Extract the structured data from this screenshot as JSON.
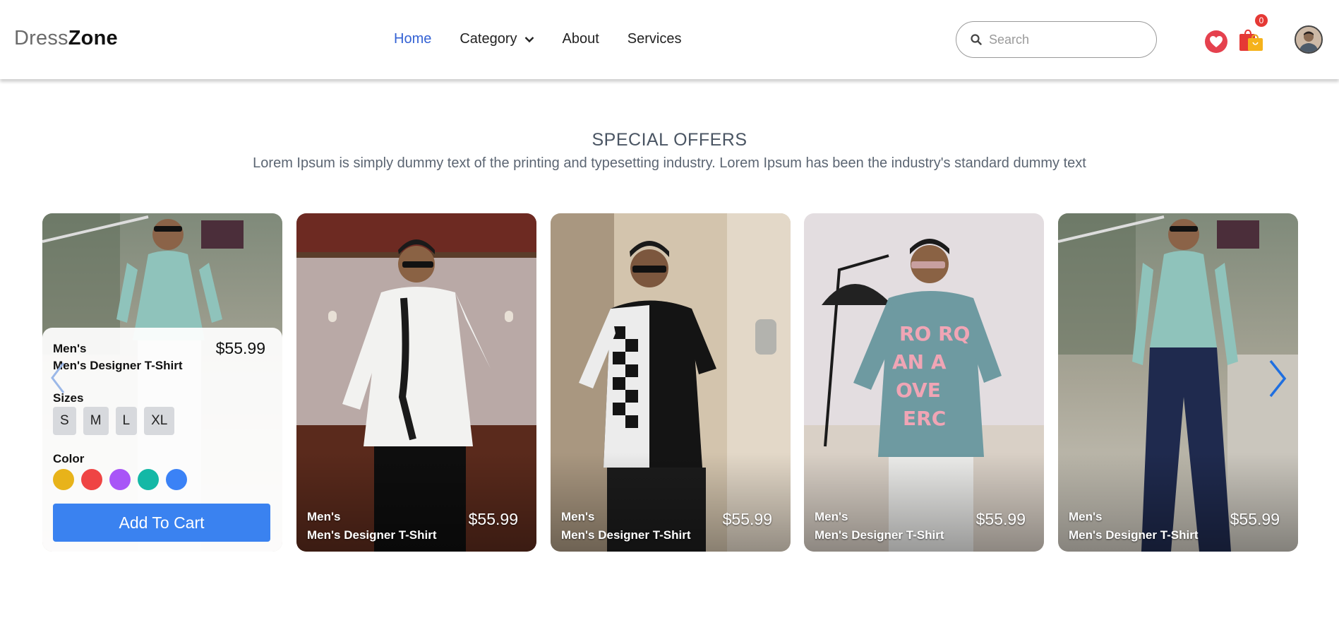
{
  "brand": {
    "part1": "Dress",
    "part2": "Zone"
  },
  "nav": {
    "home": "Home",
    "category": "Category",
    "about": "About",
    "services": "Services"
  },
  "search": {
    "placeholder": "Search",
    "value": ""
  },
  "cart": {
    "count": "0"
  },
  "section": {
    "title": "SPECIAL OFFERS",
    "subtitle": "Lorem Ipsum is simply dummy text of the printing and typesetting industry. Lorem Ipsum has been the industry's standard dummy text"
  },
  "products": [
    {
      "category": "Men's",
      "name": "Men's Designer T-Shirt",
      "price": "$55.99"
    },
    {
      "category": "Men's",
      "name": "Men's Designer T-Shirt",
      "price": "$55.99"
    },
    {
      "category": "Men's",
      "name": "Men's Designer T-Shirt",
      "price": "$55.99"
    },
    {
      "category": "Men's",
      "name": "Men's Designer T-Shirt",
      "price": "$55.99"
    },
    {
      "category": "Men's",
      "name": "Men's Designer T-Shirt",
      "price": "$55.99"
    }
  ],
  "detail": {
    "sizes_label": "Sizes",
    "sizes": [
      "S",
      "M",
      "L",
      "XL"
    ],
    "color_label": "Color",
    "colors": [
      "#e8b31a",
      "#ef4444",
      "#a855f7",
      "#14b8a6",
      "#3b82f6"
    ],
    "add_to_cart": "Add To Cart"
  },
  "colors": {
    "accent": "#3a82f0",
    "nav_active": "#3462d4",
    "heart": "#e5414e",
    "badge": "#e53935"
  }
}
